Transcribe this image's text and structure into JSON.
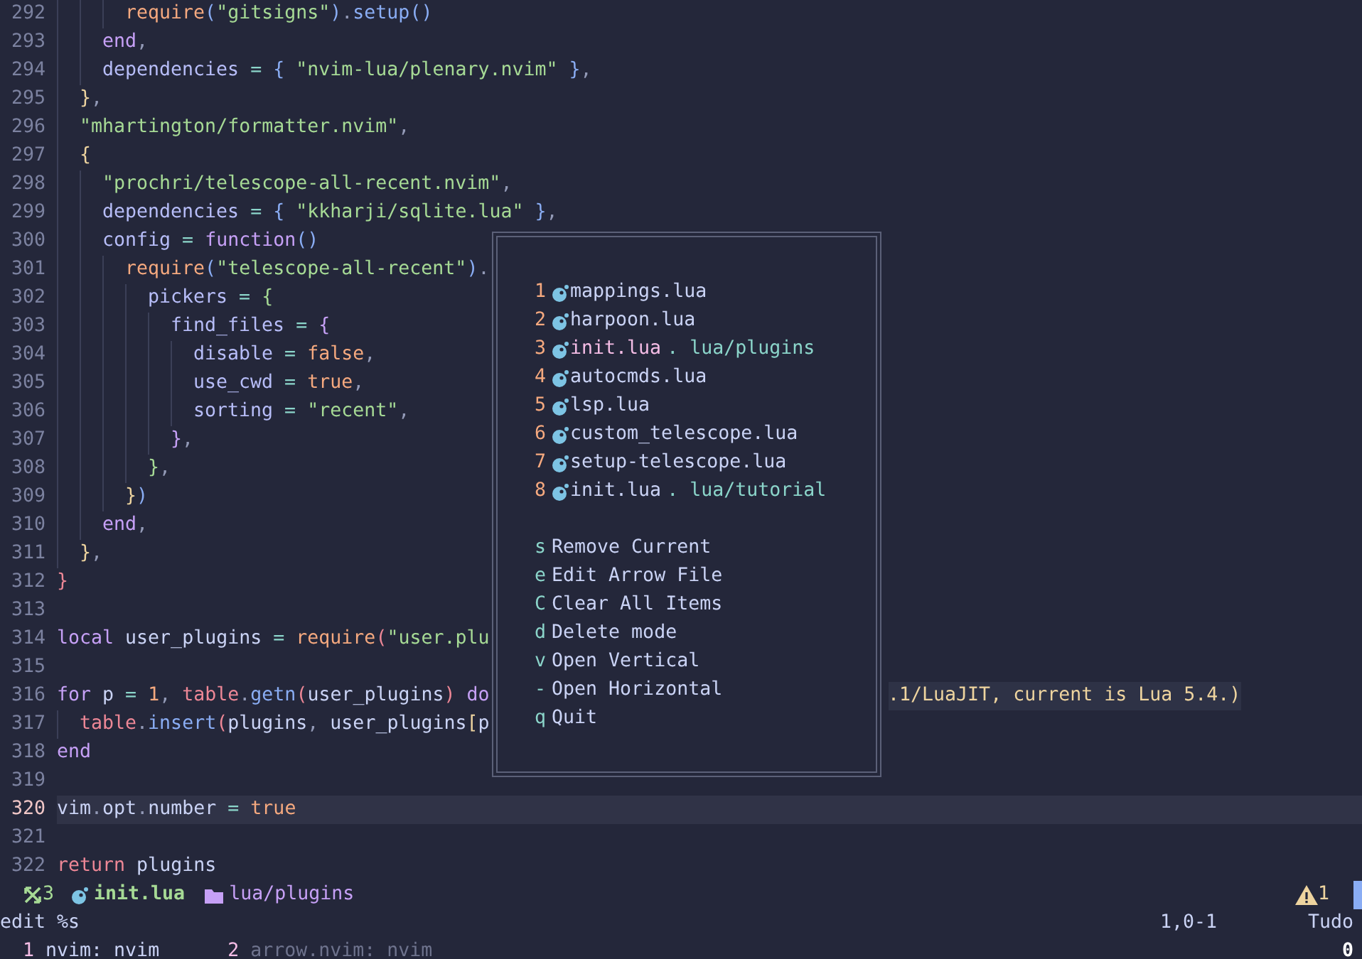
{
  "code_lines": [
    {
      "number": "292",
      "current": false,
      "tokens": [
        {
          "kind": "fn",
          "text": "      require"
        },
        {
          "kind": "b3",
          "text": "("
        },
        {
          "kind": "str",
          "text": "\"gitsigns\""
        },
        {
          "kind": "b3",
          "text": ")"
        },
        {
          "kind": "punc",
          "text": "."
        },
        {
          "kind": "method",
          "text": "setup"
        },
        {
          "kind": "b3",
          "text": "()"
        }
      ]
    },
    {
      "number": "293",
      "current": false,
      "tokens": [
        {
          "kind": "kw",
          "text": "    end"
        },
        {
          "kind": "punc",
          "text": ","
        }
      ]
    },
    {
      "number": "294",
      "current": false,
      "tokens": [
        {
          "kind": "prop",
          "text": "    dependencies"
        },
        {
          "kind": "op",
          "text": " = "
        },
        {
          "kind": "b3",
          "text": "{ "
        },
        {
          "kind": "str",
          "text": "\"nvim-lua/plenary.nvim\" "
        },
        {
          "kind": "b3",
          "text": "}"
        },
        {
          "kind": "punc",
          "text": ","
        }
      ]
    },
    {
      "number": "295",
      "current": false,
      "tokens": [
        {
          "kind": "b1",
          "text": "  }"
        },
        {
          "kind": "punc",
          "text": ","
        }
      ]
    },
    {
      "number": "296",
      "current": false,
      "tokens": [
        {
          "kind": "str",
          "text": "  \"mhartington/formatter.nvim\""
        },
        {
          "kind": "punc",
          "text": ","
        }
      ]
    },
    {
      "number": "297",
      "current": false,
      "tokens": [
        {
          "kind": "b1",
          "text": "  {"
        }
      ]
    },
    {
      "number": "298",
      "current": false,
      "tokens": [
        {
          "kind": "str",
          "text": "    \"prochri/telescope-all-recent.nvim\""
        },
        {
          "kind": "punc",
          "text": ","
        }
      ]
    },
    {
      "number": "299",
      "current": false,
      "tokens": [
        {
          "kind": "prop",
          "text": "    dependencies"
        },
        {
          "kind": "op",
          "text": " = "
        },
        {
          "kind": "b3",
          "text": "{ "
        },
        {
          "kind": "str",
          "text": "\"kkharji/sqlite.lua\" "
        },
        {
          "kind": "b3",
          "text": "}"
        },
        {
          "kind": "punc",
          "text": ","
        }
      ]
    },
    {
      "number": "300",
      "current": false,
      "tokens": [
        {
          "kind": "prop",
          "text": "    config"
        },
        {
          "kind": "op",
          "text": " = "
        },
        {
          "kind": "kw",
          "text": "function"
        },
        {
          "kind": "b3",
          "text": "()"
        }
      ]
    },
    {
      "number": "301",
      "current": false,
      "tokens": [
        {
          "kind": "fn",
          "text": "      require"
        },
        {
          "kind": "b3",
          "text": "("
        },
        {
          "kind": "str",
          "text": "\"telescope-all-recent\""
        },
        {
          "kind": "b3",
          "text": ")"
        },
        {
          "kind": "punc",
          "text": "."
        }
      ]
    },
    {
      "number": "302",
      "current": false,
      "tokens": [
        {
          "kind": "prop",
          "text": "        pickers"
        },
        {
          "kind": "op",
          "text": " = "
        },
        {
          "kind": "b5",
          "text": "{"
        }
      ]
    },
    {
      "number": "303",
      "current": false,
      "tokens": [
        {
          "kind": "prop",
          "text": "          find_files"
        },
        {
          "kind": "op",
          "text": " = "
        },
        {
          "kind": "b2",
          "text": "{"
        }
      ]
    },
    {
      "number": "304",
      "current": false,
      "tokens": [
        {
          "kind": "prop",
          "text": "            disable"
        },
        {
          "kind": "op",
          "text": " = "
        },
        {
          "kind": "bool",
          "text": "false"
        },
        {
          "kind": "punc",
          "text": ","
        }
      ]
    },
    {
      "number": "305",
      "current": false,
      "tokens": [
        {
          "kind": "prop",
          "text": "            use_cwd"
        },
        {
          "kind": "op",
          "text": " = "
        },
        {
          "kind": "bool",
          "text": "true"
        },
        {
          "kind": "punc",
          "text": ","
        }
      ]
    },
    {
      "number": "306",
      "current": false,
      "tokens": [
        {
          "kind": "prop",
          "text": "            sorting"
        },
        {
          "kind": "op",
          "text": " = "
        },
        {
          "kind": "str",
          "text": "\"recent\""
        },
        {
          "kind": "punc",
          "text": ","
        }
      ]
    },
    {
      "number": "307",
      "current": false,
      "tokens": [
        {
          "kind": "b2",
          "text": "          }"
        },
        {
          "kind": "punc",
          "text": ","
        }
      ]
    },
    {
      "number": "308",
      "current": false,
      "tokens": [
        {
          "kind": "b5",
          "text": "        }"
        },
        {
          "kind": "punc",
          "text": ","
        }
      ]
    },
    {
      "number": "309",
      "current": false,
      "tokens": [
        {
          "kind": "b1",
          "text": "      }"
        },
        {
          "kind": "b3",
          "text": ")"
        }
      ]
    },
    {
      "number": "310",
      "current": false,
      "tokens": [
        {
          "kind": "kw",
          "text": "    end"
        },
        {
          "kind": "punc",
          "text": ","
        }
      ]
    },
    {
      "number": "311",
      "current": false,
      "tokens": [
        {
          "kind": "b1",
          "text": "  }"
        },
        {
          "kind": "punc",
          "text": ","
        }
      ]
    },
    {
      "number": "312",
      "current": false,
      "tokens": [
        {
          "kind": "b4",
          "text": "}"
        }
      ]
    },
    {
      "number": "313",
      "current": false
    },
    {
      "number": "314",
      "current": false,
      "tokens": [
        {
          "kind": "kw",
          "text": "local"
        },
        {
          "kind": "var",
          "text": " user_plugins"
        },
        {
          "kind": "op",
          "text": " = "
        },
        {
          "kind": "fn",
          "text": "require"
        },
        {
          "kind": "b4",
          "text": "("
        },
        {
          "kind": "str",
          "text": "\"user.plu"
        }
      ]
    },
    {
      "number": "315",
      "current": false
    },
    {
      "number": "316",
      "current": false,
      "tokens": [
        {
          "kind": "kw",
          "text": "for"
        },
        {
          "kind": "var",
          "text": " p"
        },
        {
          "kind": "op",
          "text": " = "
        },
        {
          "kind": "num",
          "text": "1"
        },
        {
          "kind": "punc",
          "text": ", "
        },
        {
          "kind": "builtin",
          "text": "table"
        },
        {
          "kind": "punc",
          "text": "."
        },
        {
          "kind": "method",
          "text": "getn"
        },
        {
          "kind": "b4",
          "text": "("
        },
        {
          "kind": "var",
          "text": "user_plugins"
        },
        {
          "kind": "b4",
          "text": ")"
        },
        {
          "kind": "kw",
          "text": " do"
        }
      ],
      "diagnostic": ".1/LuaJIT, current is Lua 5.4.)"
    },
    {
      "number": "317",
      "current": false,
      "tokens": [
        {
          "kind": "builtin",
          "text": "  table"
        },
        {
          "kind": "punc",
          "text": "."
        },
        {
          "kind": "method",
          "text": "insert"
        },
        {
          "kind": "b4",
          "text": "("
        },
        {
          "kind": "var",
          "text": "plugins"
        },
        {
          "kind": "punc",
          "text": ", "
        },
        {
          "kind": "var",
          "text": "user_plugins"
        },
        {
          "kind": "b1",
          "text": "["
        },
        {
          "kind": "var",
          "text": "p"
        }
      ]
    },
    {
      "number": "318",
      "current": false,
      "tokens": [
        {
          "kind": "kw",
          "text": "end"
        }
      ]
    },
    {
      "number": "319",
      "current": false
    },
    {
      "number": "320",
      "current": true,
      "tokens": [
        {
          "kind": "var",
          "text": "vim"
        },
        {
          "kind": "punc",
          "text": "."
        },
        {
          "kind": "var",
          "text": "opt"
        },
        {
          "kind": "punc",
          "text": "."
        },
        {
          "kind": "var",
          "text": "number"
        },
        {
          "kind": "op",
          "text": " = "
        },
        {
          "kind": "bool",
          "text": "true"
        }
      ]
    },
    {
      "number": "321",
      "current": false
    },
    {
      "number": "322",
      "current": false,
      "tokens": [
        {
          "kind": "builtin",
          "text": "return"
        },
        {
          "kind": "var",
          "text": " plugins"
        }
      ]
    }
  ],
  "arrow_menu": {
    "files": [
      {
        "key": "1",
        "name": "mappings.lua",
        "current": false
      },
      {
        "key": "2",
        "name": "harpoon.lua",
        "current": false
      },
      {
        "key": "3",
        "name": "init.lua",
        "path": ". lua/plugins",
        "current": true
      },
      {
        "key": "4",
        "name": "autocmds.lua",
        "current": false
      },
      {
        "key": "5",
        "name": "lsp.lua",
        "current": false
      },
      {
        "key": "6",
        "name": "custom_telescope.lua",
        "current": false
      },
      {
        "key": "7",
        "name": "setup-telescope.lua",
        "current": false
      },
      {
        "key": "8",
        "name": "init.lua",
        "path": ". lua/tutorial",
        "current": false
      }
    ],
    "actions": [
      {
        "key": "s",
        "label": "Remove Current"
      },
      {
        "key": "e",
        "label": "Edit Arrow File"
      },
      {
        "key": "C",
        "label": "Clear All Items"
      },
      {
        "key": "d",
        "label": "Delete mode"
      },
      {
        "key": "v",
        "label": "Open Vertical"
      },
      {
        "key": "-",
        "label": "Open Horizontal"
      },
      {
        "key": "q",
        "label": "Quit"
      }
    ]
  },
  "status_line": {
    "arrow_count": "3",
    "file": "init.lua",
    "directory": "lua/plugins",
    "warnings": "1"
  },
  "command_line": {
    "text": "edit %s",
    "position": "1,0-1",
    "scroll": "Tudo"
  },
  "tmux_bar": {
    "windows": [
      {
        "index": "1",
        "name": "nvim: nvim",
        "selected": true
      },
      {
        "index": "2",
        "name": "arrow.nvim: nvim",
        "selected": false
      }
    ],
    "session": "0"
  }
}
